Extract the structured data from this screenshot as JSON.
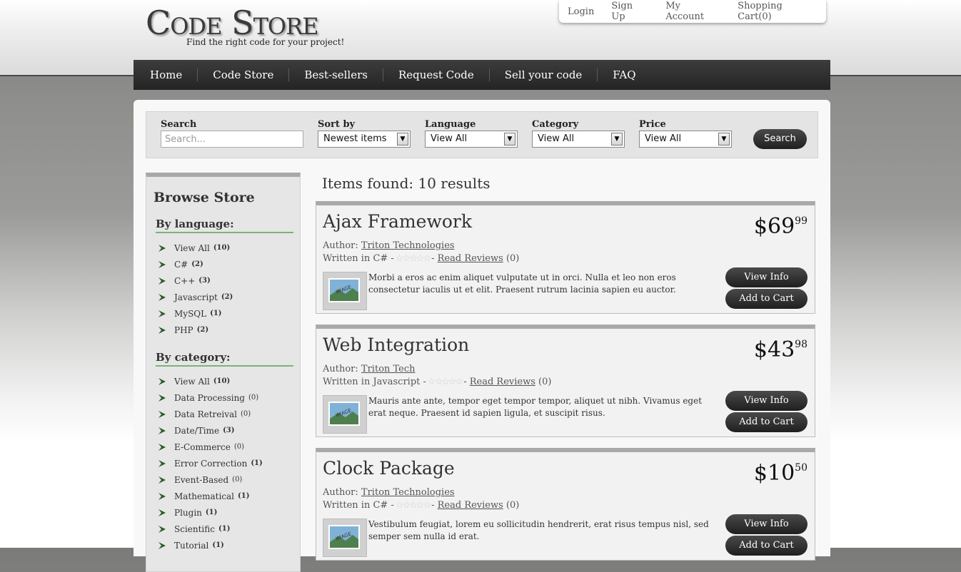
{
  "logo": {
    "title": "Code Store",
    "subtitle": "Find the right code for your project!"
  },
  "account": {
    "login": "Login",
    "signup": "Sign Up",
    "my_account": "My Account",
    "cart": "Shopping Cart(0)"
  },
  "nav": [
    "Home",
    "Code Store",
    "Best-sellers",
    "Request Code",
    "Sell your code",
    "FAQ"
  ],
  "filters": {
    "search_label": "Search",
    "search_placeholder": "Search...",
    "sort_label": "Sort by",
    "sort_value": "Newest items",
    "language_label": "Language",
    "language_value": "View All",
    "category_label": "Category",
    "category_value": "View All",
    "price_label": "Price",
    "price_value": "View All",
    "button": "Search"
  },
  "sidebar": {
    "title": "Browse Store",
    "language_heading": "By language:",
    "languages": [
      {
        "label": "View All",
        "count": "(10)"
      },
      {
        "label": "C#",
        "count": "(2)"
      },
      {
        "label": "C++",
        "count": "(3)"
      },
      {
        "label": "Javascript",
        "count": "(2)"
      },
      {
        "label": "MySQL",
        "count": "(1)"
      },
      {
        "label": "PHP",
        "count": "(2)"
      }
    ],
    "category_heading": "By category:",
    "categories": [
      {
        "label": "View All",
        "count": "(10)"
      },
      {
        "label": "Data Processing",
        "count": "(0)"
      },
      {
        "label": "Data Retreival",
        "count": "(0)"
      },
      {
        "label": "Date/Time",
        "count": "(3)"
      },
      {
        "label": "E-Commerce",
        "count": "(0)"
      },
      {
        "label": "Error Correction",
        "count": "(1)"
      },
      {
        "label": "Event-Based",
        "count": "(0)"
      },
      {
        "label": "Mathematical",
        "count": "(1)"
      },
      {
        "label": "Plugin",
        "count": "(1)"
      },
      {
        "label": "Scientific",
        "count": "(1)"
      },
      {
        "label": "Tutorial",
        "count": "(1)"
      }
    ]
  },
  "results_title": "Items found: 10 results",
  "items": [
    {
      "name": "Ajax Framework",
      "author_label": "Author:",
      "author": "Triton Technologies",
      "written_label": "Written in C# -",
      "rating": 0,
      "reviews_link": "Read Reviews",
      "reviews_count": "(0)",
      "thumb_text": "IMAGE",
      "description": "Morbi a eros ac enim aliquet vulputate ut in orci. Nulla et leo non eros consectetur iaculis ut et elit. Praesent rutrum lacinia sapien eu auctor.",
      "price_dollars": "$69",
      "price_cents": "99",
      "view_info": "View Info",
      "add_to_cart": "Add to Cart"
    },
    {
      "name": "Web Integration",
      "author_label": "Author:",
      "author": "Triton Tech",
      "written_label": "Written in Javascript -",
      "rating": 0,
      "reviews_link": "Read Reviews",
      "reviews_count": "(0)",
      "thumb_text": "IMAGE",
      "description": "Mauris ante ante, tempor eget tempor tempor, aliquet ut nibh. Vivamus eget erat neque. Praesent id sapien ligula, et suscipit risus.",
      "price_dollars": "$43",
      "price_cents": "98",
      "view_info": "View Info",
      "add_to_cart": "Add to Cart"
    },
    {
      "name": "Clock Package",
      "author_label": "Author:",
      "author": "Triton Technologies",
      "written_label": "Written in C# -",
      "rating": 0,
      "reviews_link": "Read Reviews",
      "reviews_count": "(0)",
      "thumb_text": "IMAGE",
      "description": "Vestibulum feugiat, lorem eu sollicitudin hendrerit, erat risus tempus nisl, sed semper sem nulla id erat.",
      "price_dollars": "$10",
      "price_cents": "50",
      "view_info": "View Info",
      "add_to_cart": "Add to Cart"
    }
  ]
}
